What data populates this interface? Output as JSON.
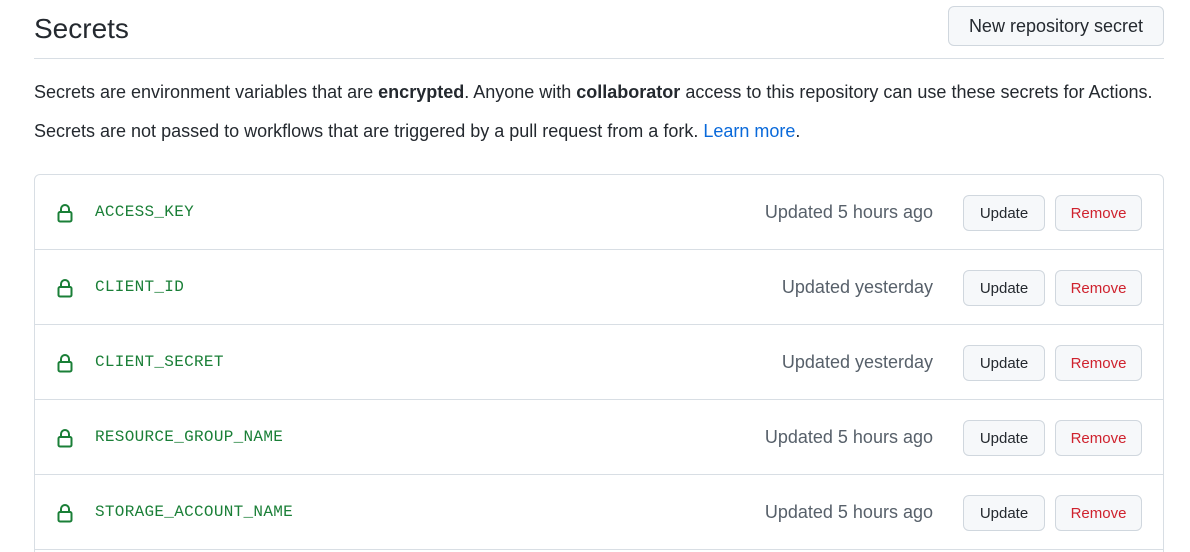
{
  "header": {
    "title": "Secrets",
    "new_secret_label": "New repository secret"
  },
  "description": {
    "line1_a": "Secrets are environment variables that are ",
    "line1_b": "encrypted",
    "line1_c": ". Anyone with ",
    "line1_d": "collaborator",
    "line1_e": " access to this repository can use these secrets for Actions.",
    "line2_a": "Secrets are not passed to workflows that are triggered by a pull request from a fork. ",
    "line2_link": "Learn more",
    "line2_end": "."
  },
  "colors": {
    "secret_name": "#1a7f37",
    "link": "#0969da",
    "remove": "#cf222e"
  },
  "secrets": [
    {
      "name": "ACCESS_KEY",
      "updated": "Updated 5 hours ago",
      "update_label": "Update",
      "remove_label": "Remove",
      "icon": "lock-icon"
    },
    {
      "name": "CLIENT_ID",
      "updated": "Updated yesterday",
      "update_label": "Update",
      "remove_label": "Remove",
      "icon": "lock-icon"
    },
    {
      "name": "CLIENT_SECRET",
      "updated": "Updated yesterday",
      "update_label": "Update",
      "remove_label": "Remove",
      "icon": "lock-icon"
    },
    {
      "name": "RESOURCE_GROUP_NAME",
      "updated": "Updated 5 hours ago",
      "update_label": "Update",
      "remove_label": "Remove",
      "icon": "lock-icon"
    },
    {
      "name": "STORAGE_ACCOUNT_NAME",
      "updated": "Updated 5 hours ago",
      "update_label": "Update",
      "remove_label": "Remove",
      "icon": "lock-icon"
    }
  ]
}
